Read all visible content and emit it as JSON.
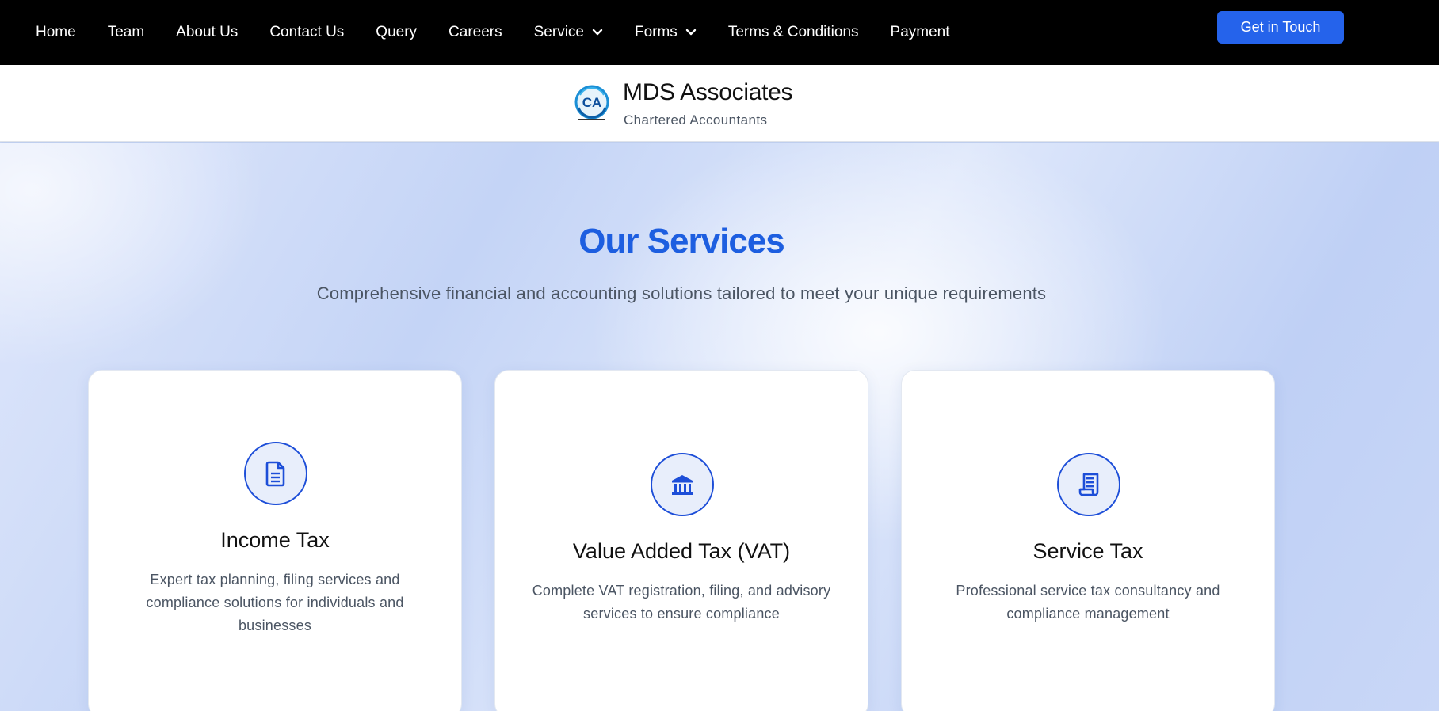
{
  "nav": {
    "items": [
      {
        "label": "Home"
      },
      {
        "label": "Team"
      },
      {
        "label": "About Us"
      },
      {
        "label": "Contact Us"
      },
      {
        "label": "Query"
      },
      {
        "label": "Careers"
      },
      {
        "label": "Service",
        "icon": "chevron-down-icon"
      },
      {
        "label": "Forms",
        "icon": "chevron-down-icon"
      },
      {
        "label": "Terms & Conditions"
      },
      {
        "label": "Payment"
      }
    ],
    "cta_label": "Get in Touch"
  },
  "brand": {
    "name": "MDS Associates",
    "tagline": "Chartered Accountants",
    "logo_text": "CA",
    "logo_icon": "ca-logo-icon"
  },
  "services": {
    "title": "Our Services",
    "subtitle": "Comprehensive financial and accounting solutions tailored to meet your unique requirements",
    "cards": [
      {
        "title": "Income Tax",
        "description": "Expert tax planning, filing services and compliance solutions for individuals and businesses",
        "icon": "document-icon"
      },
      {
        "title": "Value Added Tax (VAT)",
        "description": "Complete VAT registration, filing, and advisory services to ensure compliance",
        "icon": "bank-icon"
      },
      {
        "title": "Service Tax",
        "description": "Professional service tax consultancy and compliance management",
        "icon": "receipt-icon"
      }
    ]
  },
  "colors": {
    "nav_background": "#000000",
    "accent": "#2563eb",
    "title_blue": "#1d5ee0",
    "icon_blue": "#1d4ed8"
  }
}
